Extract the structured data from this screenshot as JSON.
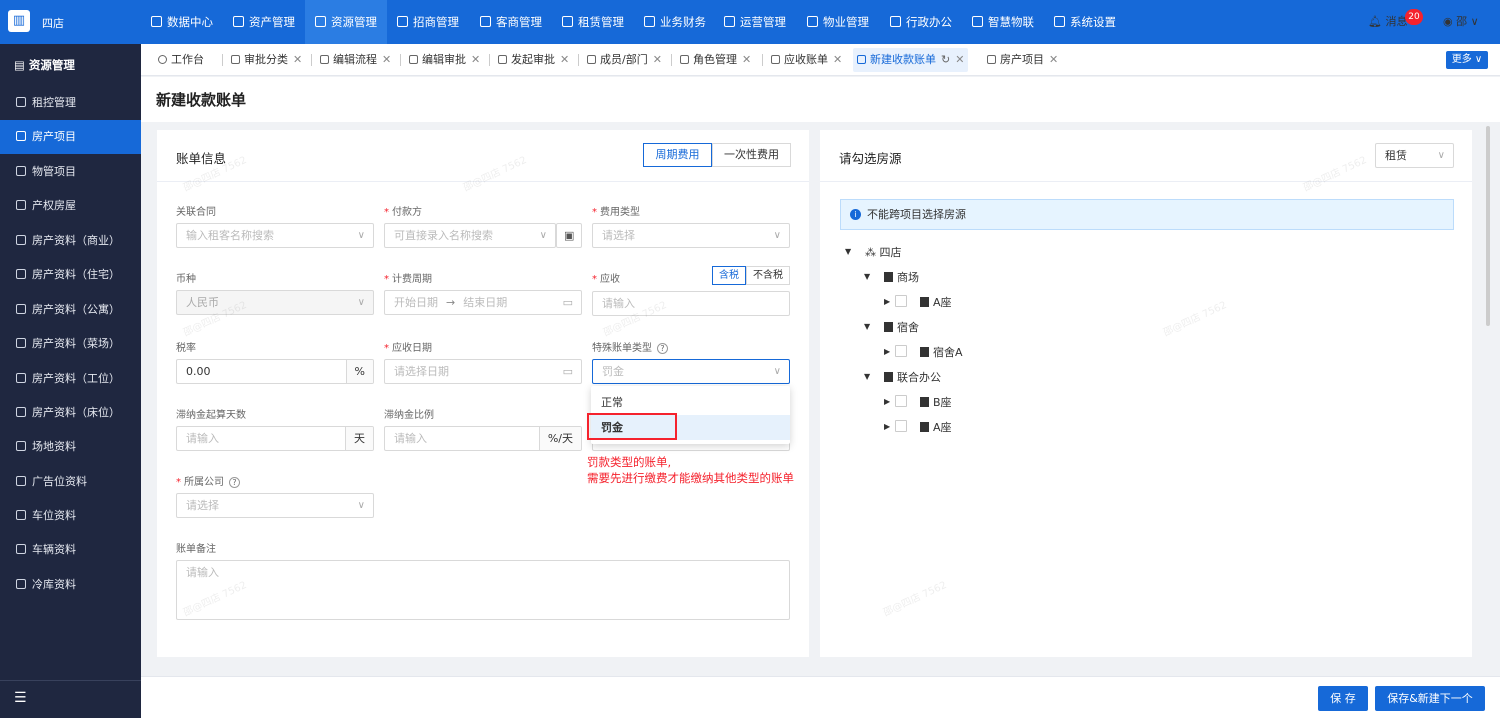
{
  "topbar": {
    "org": "四店",
    "nav": [
      "数据中心",
      "资产管理",
      "资源管理",
      "招商管理",
      "客商管理",
      "租赁管理",
      "业务财务",
      "运营管理",
      "物业管理",
      "行政办公",
      "智慧物联",
      "系统设置"
    ],
    "active_nav": "资源管理",
    "messages_label": "消息",
    "messages_count": "20",
    "user": "邵 ∨"
  },
  "sidebar": {
    "title": "资源管理",
    "items": [
      "租控管理",
      "房产项目",
      "物管项目",
      "产权房屋",
      "房产资料（商业）",
      "房产资料（住宅）",
      "房产资料（公寓）",
      "房产资料（菜场）",
      "房产资料（工位）",
      "房产资料（床位）",
      "场地资料",
      "广告位资料",
      "车位资料",
      "车辆资料",
      "冷库资料"
    ],
    "active": "房产项目",
    "collapse_icon": "☰"
  },
  "tabs": {
    "items": [
      "工作台",
      "审批分类",
      "编辑流程",
      "编辑审批",
      "发起审批",
      "成员/部门",
      "角色管理",
      "应收账单",
      "新建收款账单",
      "房产项目"
    ],
    "active": "新建收款账单",
    "more": "更多 ∨"
  },
  "page": {
    "title": "新建收款账单"
  },
  "bill": {
    "section_title": "账单信息",
    "mode_periodic": "周期费用",
    "mode_once": "一次性费用",
    "contract_label": "关联合同",
    "contract_placeholder": "输入租客名称搜索",
    "payer_label": "付款方",
    "payer_placeholder": "可直接录入名称搜索",
    "fee_type_label": "费用类型",
    "fee_type_placeholder": "请选择",
    "currency_label": "币种",
    "currency_value": "人民币",
    "period_label": "计费周期",
    "period_start": "开始日期",
    "period_arrow": "→",
    "period_end": "结束日期",
    "receivable_label": "应收",
    "tax_incl": "含税",
    "tax_excl": "不含税",
    "receivable_placeholder": "请输入",
    "tax_rate_label": "税率",
    "tax_rate_value": "0.00",
    "tax_rate_suffix": "%",
    "due_date_label": "应收日期",
    "due_date_placeholder": "请选择日期",
    "special_label": "特殊账单类型",
    "special_value": "罚金",
    "late_days_label": "滞纳金起算天数",
    "late_days_placeholder": "请输入",
    "late_days_suffix": "天",
    "late_ratio_label": "滞纳金比例",
    "late_ratio_placeholder": "请输入",
    "late_ratio_suffix": "%/天",
    "company_label": "所属公司",
    "company_placeholder": "请选择",
    "remark_label": "账单备注",
    "remark_placeholder": "请输入",
    "dropdown_options": [
      "正常",
      "罚金"
    ],
    "note_line1": "罚款类型的账单,",
    "note_line2": "需要先进行缴费才能缴纳其他类型的账单"
  },
  "house": {
    "title": "请勾选房源",
    "type_value": "租赁",
    "info": "不能跨项目选择房源",
    "tree": {
      "root": "四店",
      "mall": "商场",
      "mall_a": "A座",
      "dorm": "宿舍",
      "dorm_a": "宿舍A",
      "office": "联合办公",
      "office_b": "B座",
      "office_a": "A座"
    }
  },
  "footer": {
    "save": "保 存",
    "save_next": "保存&新建下一个"
  },
  "watermark": "邵@四店 7562",
  "colors": {
    "primary": "#1669d8",
    "sidebar": "#1f2740",
    "alert": "#f5222d"
  }
}
